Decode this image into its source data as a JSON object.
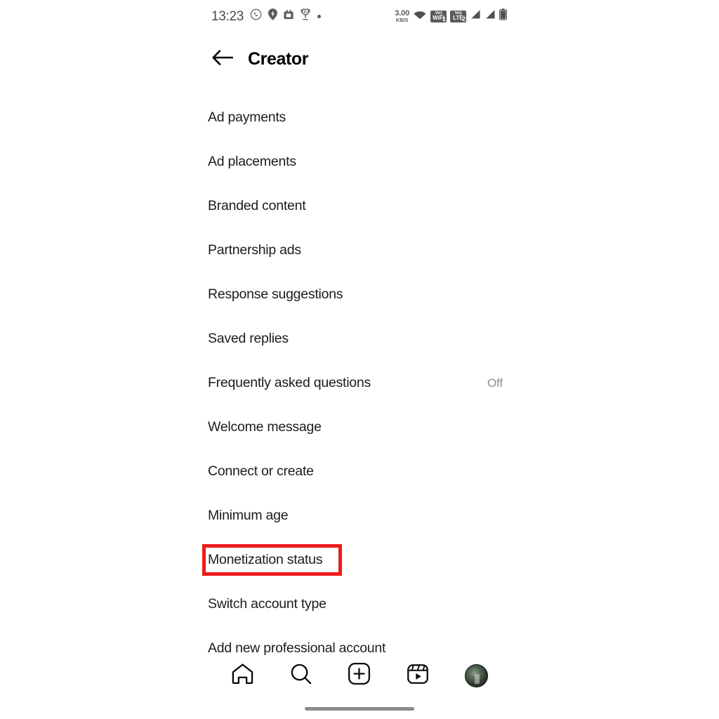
{
  "status_bar": {
    "time": "13:23",
    "left_icons": [
      "whatsapp-icon",
      "location-pin-icon",
      "camera-app-icon",
      "trophy-icon",
      "dot-icon"
    ],
    "network_speed_value": "3.00",
    "network_speed_unit": "KB/S",
    "wifi_icon": "wifi-icon",
    "volte_badges": [
      {
        "line1": "Vo)",
        "line2": "WiFi",
        "sim": "1"
      },
      {
        "line1": "Vo)",
        "line2": "LTE",
        "sim": "2"
      }
    ],
    "signal_icons": [
      "signal-bars-sim1-icon",
      "signal-bars-sim2-icon"
    ],
    "battery_icon": "battery-icon"
  },
  "header": {
    "back_icon": "back-arrow-icon",
    "title": "Creator"
  },
  "settings": {
    "items": [
      {
        "label": "Ad payments",
        "value": "",
        "highlighted": false
      },
      {
        "label": "Ad placements",
        "value": "",
        "highlighted": false
      },
      {
        "label": "Branded content",
        "value": "",
        "highlighted": false
      },
      {
        "label": "Partnership ads",
        "value": "",
        "highlighted": false
      },
      {
        "label": "Response suggestions",
        "value": "",
        "highlighted": false
      },
      {
        "label": "Saved replies",
        "value": "",
        "highlighted": false
      },
      {
        "label": "Frequently asked questions",
        "value": "Off",
        "highlighted": false
      },
      {
        "label": "Welcome message",
        "value": "",
        "highlighted": false
      },
      {
        "label": "Connect or create",
        "value": "",
        "highlighted": false
      },
      {
        "label": "Minimum age",
        "value": "",
        "highlighted": false
      },
      {
        "label": "Monetization status",
        "value": "",
        "highlighted": true
      },
      {
        "label": "Switch account type",
        "value": "",
        "highlighted": false
      },
      {
        "label": "Add new professional account",
        "value": "",
        "highlighted": false
      }
    ]
  },
  "bottom_nav": {
    "items": [
      {
        "name": "home-icon"
      },
      {
        "name": "search-icon"
      },
      {
        "name": "create-post-icon"
      },
      {
        "name": "reels-icon"
      },
      {
        "name": "profile-avatar"
      }
    ]
  },
  "colors": {
    "highlight": "#ee1b1b",
    "text_primary": "#1c1c1c",
    "text_secondary": "#8e8e8e",
    "background": "#ffffff"
  }
}
